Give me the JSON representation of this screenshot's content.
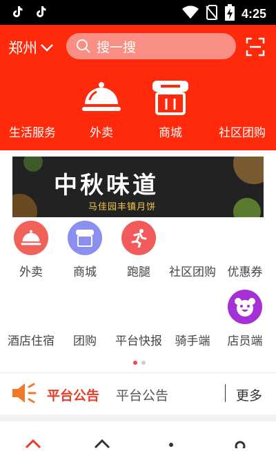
{
  "status_bar": {
    "time": "4:25"
  },
  "header": {
    "city": "郑州",
    "search_placeholder": "搜一搜",
    "top_nav": [
      {
        "label": "生活服务",
        "icon": "none"
      },
      {
        "label": "外卖",
        "icon": "cloche-icon"
      },
      {
        "label": "商城",
        "icon": "storefront-icon"
      },
      {
        "label": "社区团购",
        "icon": "none"
      }
    ]
  },
  "banner": {
    "title": "中秋味道",
    "subtitle": "马佳园丰镇月饼"
  },
  "grid": {
    "row1": [
      {
        "label": "外卖",
        "icon": "cloche-icon",
        "color": "#f0615a"
      },
      {
        "label": "商城",
        "icon": "storefront-icon",
        "color": "#8a8ff0"
      },
      {
        "label": "跑腿",
        "icon": "runner-icon",
        "color": "#f25b5b"
      },
      {
        "label": "社区团购",
        "icon": "none"
      },
      {
        "label": "优惠券",
        "icon": "none"
      }
    ],
    "row2": [
      {
        "label": "酒店住宿",
        "icon": "none"
      },
      {
        "label": "团购",
        "icon": "none"
      },
      {
        "label": "平台快报",
        "icon": "none"
      },
      {
        "label": "骑手端",
        "icon": "none"
      },
      {
        "label": "店员端",
        "icon": "bear-face-icon",
        "color": "#a531d6"
      }
    ]
  },
  "notice": {
    "title": "平台公告",
    "text": "平台公告",
    "more": "更多"
  },
  "colors": {
    "brand_red": "#ff2a0c",
    "accent_red": "#e93b25"
  }
}
